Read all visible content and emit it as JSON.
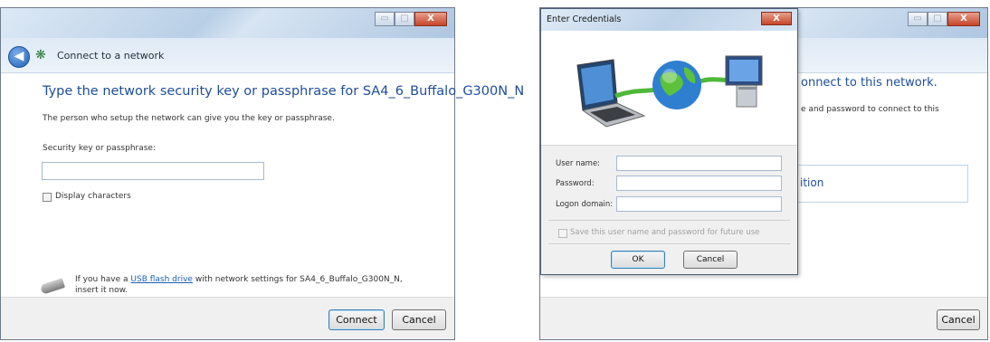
{
  "left_window": {
    "caption_buttons": [
      "▭",
      "□",
      "X"
    ],
    "nav_title": "Connect to a network",
    "heading": "Type the network security key or passphrase for SA4_6_Buffalo_G300N_N",
    "info": "The person who setup the network can give you the key or passphrase.",
    "security_label": "Security key or passphrase:",
    "security_value": "",
    "display_characters_label": "Display characters",
    "usb_text_before": "If you have a ",
    "usb_link": "USB flash drive",
    "usb_text_after": " with network settings for SA4_6_Buffalo_G300N_N,",
    "usb_text_line2": "insert it now.",
    "connect_button": "Connect",
    "cancel_button": "Cancel"
  },
  "right_window": {
    "caption_buttons": [
      "▭",
      "□",
      "X"
    ],
    "heading_partial": "onnect to this network.",
    "text_partial": "e and password to connect to this",
    "box_partial": "ition",
    "cancel_button": "Cancel"
  },
  "dialog": {
    "title": "Enter Credentials",
    "close_glyph": "X",
    "user_name_label": "User name:",
    "user_name_value": "",
    "password_label": "Password:",
    "password_value": "",
    "logon_domain_label": "Logon domain:",
    "logon_domain_value": "",
    "save_label": "Save this user name and password for future use",
    "ok_button": "OK",
    "cancel_button": "Cancel"
  }
}
